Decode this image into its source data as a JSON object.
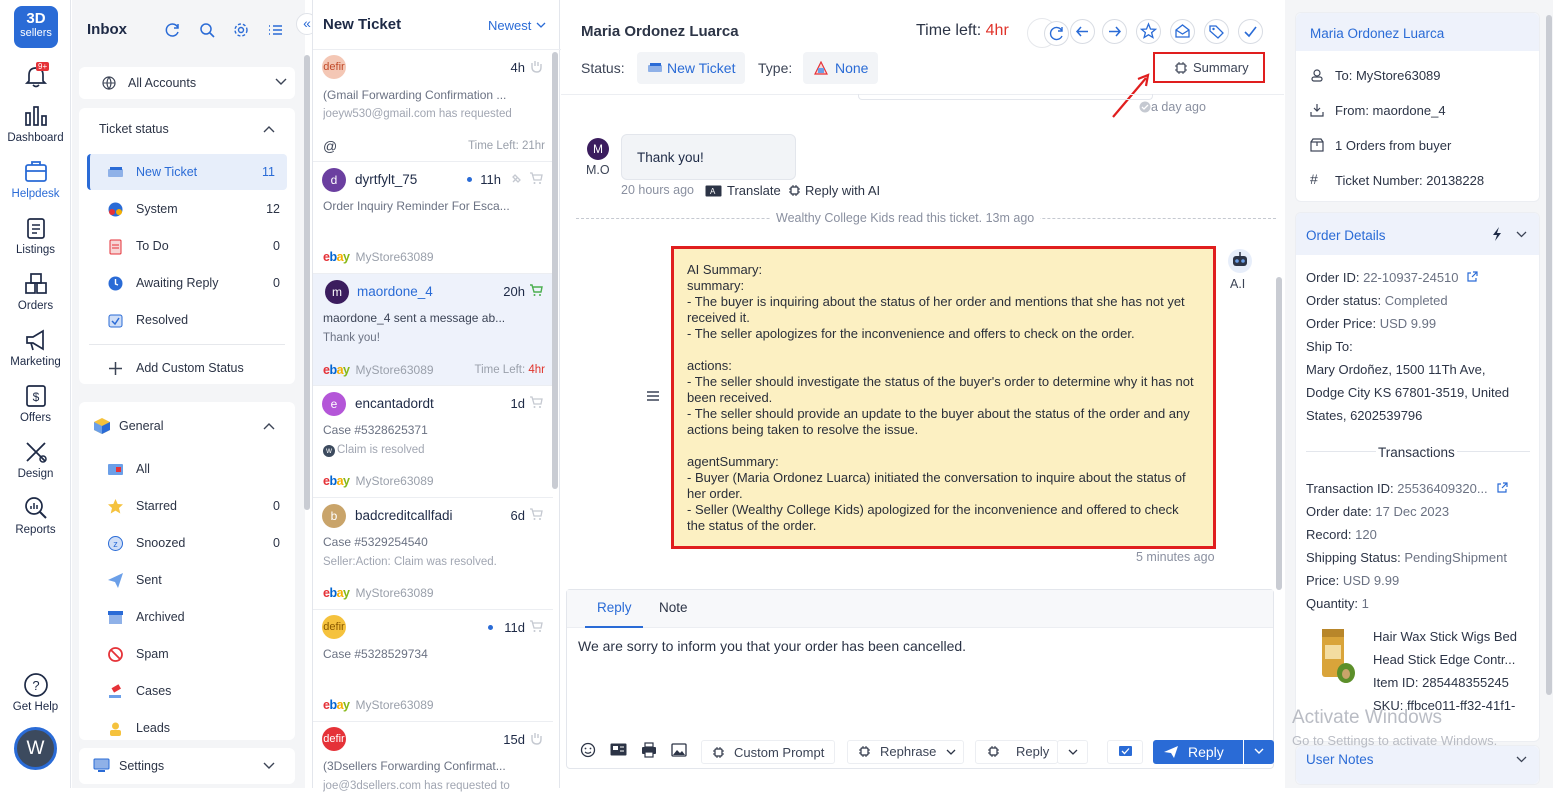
{
  "rail": {
    "logo_line1": "3D",
    "logo_line2": "sellers",
    "notif_badge": "9+",
    "items": [
      {
        "label": "Dashboard"
      },
      {
        "label": "Helpdesk"
      },
      {
        "label": "Listings"
      },
      {
        "label": "Orders"
      },
      {
        "label": "Marketing"
      },
      {
        "label": "Offers"
      },
      {
        "label": "Design"
      },
      {
        "label": "Reports"
      }
    ],
    "help_label": "Get Help",
    "avatar_letter": "W"
  },
  "nav": {
    "title": "Inbox",
    "accounts_label": "All Accounts",
    "ticket_status_label": "Ticket status",
    "statuses": [
      {
        "label": "New Ticket",
        "count": "11"
      },
      {
        "label": "System",
        "count": "12"
      },
      {
        "label": "To Do",
        "count": "0"
      },
      {
        "label": "Awaiting Reply",
        "count": "0"
      },
      {
        "label": "Resolved",
        "count": ""
      }
    ],
    "add_custom_status": "Add Custom Status",
    "general_label": "General",
    "general_items": [
      {
        "label": "All",
        "count": ""
      },
      {
        "label": "Starred",
        "count": "0"
      },
      {
        "label": "Snoozed",
        "count": "0"
      },
      {
        "label": "Sent",
        "count": ""
      },
      {
        "label": "Archived",
        "count": ""
      },
      {
        "label": "Spam",
        "count": ""
      },
      {
        "label": "Cases",
        "count": ""
      },
      {
        "label": "Leads",
        "count": ""
      }
    ],
    "settings_label": "Settings"
  },
  "list": {
    "title": "New Ticket",
    "sort_label": "Newest",
    "tickets": [
      {
        "avatar": "defir",
        "name": "",
        "time": "4h",
        "preview": "(Gmail Forwarding Confirmation ...",
        "sub": "joeyw530@gmail.com has requested",
        "store": "",
        "time_left_label": "Time Left:",
        "time_left": "21hr",
        "at_sign": "@"
      },
      {
        "avatar": "d",
        "name": "dyrtfylt_75",
        "time": "11h",
        "preview": "Order Inquiry Reminder For Esca...",
        "sub": "",
        "store": "MyStore63089",
        "time_left_label": "",
        "time_left": ""
      },
      {
        "avatar": "m",
        "name": "maordone_4",
        "time": "20h",
        "preview": "maordone_4 sent a message ab...",
        "sub": "Thank you!",
        "store": "MyStore63089",
        "time_left_label": "Time Left:",
        "time_left": "4hr"
      },
      {
        "avatar": "e",
        "name": "encantadordt",
        "time": "1d",
        "preview": "Case #5328625371",
        "sub": "Claim is resolved",
        "store": "MyStore63089",
        "time_left_label": "",
        "time_left": ""
      },
      {
        "avatar": "b",
        "name": "badcreditcallfadi",
        "time": "6d",
        "preview": "Case #5329254540",
        "sub": "Seller:Action: Claim was resolved.",
        "store": "MyStore63089",
        "time_left_label": "",
        "time_left": ""
      },
      {
        "avatar": "defir",
        "name": "",
        "time": "11d",
        "preview": "Case #5328529734",
        "sub": "",
        "store": "MyStore63089",
        "time_left_label": "",
        "time_left": ""
      },
      {
        "avatar": "defir",
        "name": "",
        "time": "15d",
        "preview": "(3Dsellers Forwarding Confirmat...",
        "sub": "joe@3dsellers.com has requested to",
        "store": "",
        "time_left_label": "",
        "time_left": ""
      }
    ]
  },
  "main": {
    "customer_name": "Maria Ordonez Luarca",
    "time_left_label": "Time left:",
    "time_left_value": "4hr",
    "status_label": "Status:",
    "status_value": "New Ticket",
    "type_label": "Type:",
    "type_value": "None",
    "summary_button": "Summary",
    "prev_time": "a day ago",
    "sender_initial": "M",
    "sender_label": "M.O",
    "message_text": "Thank you!",
    "message_time": "20 hours ago",
    "translate_label": "Translate",
    "reply_ai_label": "Reply with AI",
    "read_notice": "Wealthy College Kids read this ticket. 13m ago",
    "ai_label": "A.I",
    "ai_summary_text": "AI Summary:\nsummary:\n- The buyer is inquiring about the status of her order and mentions that she has not yet received it.\n- The seller apologizes for the inconvenience and offers to check on the order.\n\nactions:\n- The seller should investigate the status of the buyer's order to determine why it has not been received.\n- The seller should provide an update to the buyer about the status of the order and any actions being taken to resolve the issue.\n\nagentSummary:\n- Buyer (Maria Ordonez Luarca) initiated the conversation to inquire about the status of her order.\n- Seller (Wealthy College Kids) apologized for the inconvenience and offered to check the status of the order.",
    "ai_time": "5 minutes ago",
    "reply_tab": "Reply",
    "note_tab": "Note",
    "reply_text": "We are sorry to inform you that your order has been cancelled.",
    "custom_prompt": "Custom Prompt",
    "rephrase": "Rephrase",
    "reply_ai_btn": "Reply",
    "send_btn": "Reply"
  },
  "right": {
    "customer_name": "Maria Ordonez Luarca",
    "to": "To: MyStore63089",
    "from": "From: maordone_4",
    "orders": "1 Orders from buyer",
    "ticket_number": "Ticket Number: 20138228",
    "order_details_title": "Order Details",
    "order_id_k": "Order ID:",
    "order_id_v": "22-10937-24510",
    "order_status_k": "Order status:",
    "order_status_v": "Completed",
    "order_price_k": "Order Price:",
    "order_price_v": "USD 9.99",
    "ship_to_k": "Ship To:",
    "ship_line1": "Mary Ordoñez, 1500 11Th Ave,",
    "ship_line2": "Dodge City KS 67801-3519, United",
    "ship_line3": "States, 6202539796",
    "transactions_title": "Transactions",
    "txn_id_k": "Transaction ID:",
    "txn_id_v": "25536409320...",
    "order_date_k": "Order date:",
    "order_date_v": "17 Dec 2023",
    "record_k": "Record:",
    "record_v": "120",
    "ship_status_k": "Shipping Status:",
    "ship_status_v": "PendingShipment",
    "price_k": "Price:",
    "price_v": "USD 9.99",
    "qty_k": "Quantity:",
    "qty_v": "1",
    "item_title1": "Hair Wax Stick Wigs Bed",
    "item_title2": "Head Stick Edge Contr...",
    "item_id": "Item ID: 285448355245",
    "sku": "SKU: ffbce011-ff32-41f1-",
    "user_notes": "User Notes"
  },
  "watermark": {
    "line1": "Activate Windows",
    "line2": "Go to Settings to activate Windows."
  },
  "colors": {
    "accent": "#2a6bd6",
    "highlight_border": "#e01e1e",
    "ai_box_bg": "#fcf0c2",
    "time_left_red": "#e0342b"
  }
}
